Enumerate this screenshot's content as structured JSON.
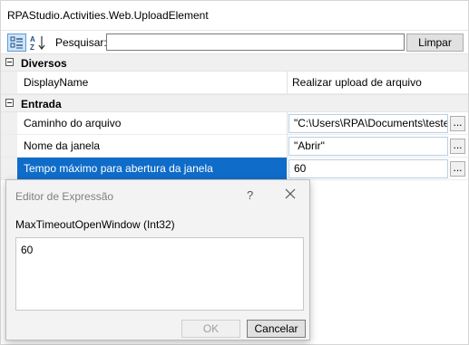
{
  "window": {
    "title": "RPAStudio.Activities.Web.UploadElement"
  },
  "toolbar": {
    "categorized_icon": "categorized-view-icon",
    "alphabetical_icon": "sort-az-icon",
    "search_label": "Pesquisar:",
    "search_value": "",
    "clear_label": "Limpar"
  },
  "categories": [
    {
      "label": "Diversos",
      "properties": [
        {
          "name": "DisplayName",
          "value": "Realizar upload de arquivo"
        }
      ]
    },
    {
      "label": "Entrada",
      "properties": [
        {
          "name": "Caminho do arquivo",
          "value": "\"C:\\Users\\RPA\\Documents\\teste",
          "button": "..."
        },
        {
          "name": "Nome da janela",
          "value": "\"Abrir\"",
          "button": "..."
        },
        {
          "name": "Tempo máximo para abertura da janela",
          "value": "60",
          "button": "...",
          "selected": true
        }
      ]
    }
  ],
  "dialog": {
    "title": "Editor de Expressão",
    "help_label": "?",
    "close_icon": "close-icon",
    "property_label": "MaxTimeoutOpenWindow (Int32)",
    "expression": "60",
    "ok_label": "OK",
    "cancel_label": "Cancelar"
  },
  "colors": {
    "selection": "#0f6cc9",
    "category_bg": "#f0f0f0"
  }
}
